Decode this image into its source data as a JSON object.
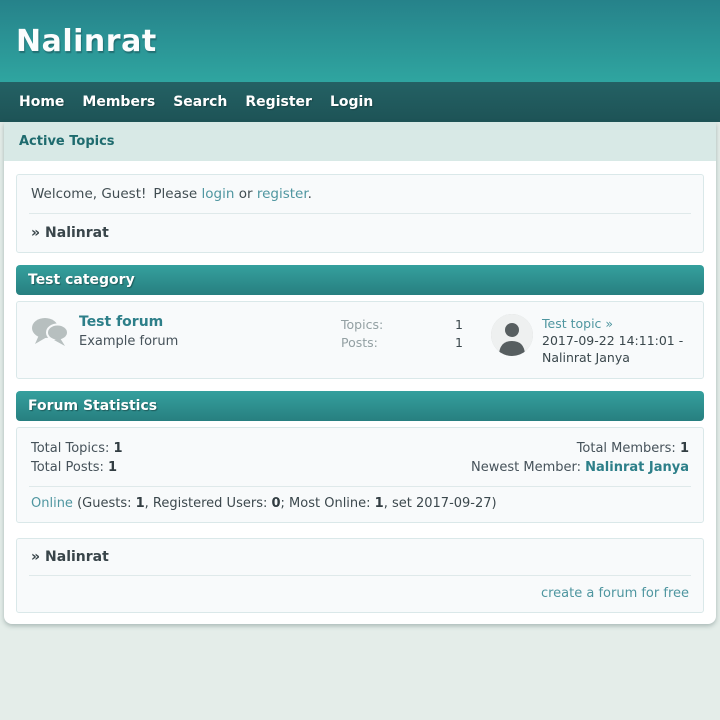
{
  "header": {
    "site_title": "Nalinrat"
  },
  "nav": {
    "items": [
      "Home",
      "Members",
      "Search",
      "Register",
      "Login"
    ]
  },
  "active_topics_bar": {
    "label": "Active Topics"
  },
  "welcome": {
    "greeting": "Welcome, Guest!",
    "please": "Please",
    "login_label": "login",
    "or": "or",
    "register_label": "register",
    "period": ".",
    "crumb_arrow": "»",
    "crumb_name": "Nalinrat"
  },
  "category": {
    "title": "Test category",
    "forum": {
      "name": "Test forum",
      "description": "Example forum",
      "topics_label": "Topics:",
      "topics_value": "1",
      "posts_label": "Posts:",
      "posts_value": "1",
      "last_topic_title": "Test topic »",
      "last_topic_date": "2017-09-22 14:11:01 -",
      "last_topic_author": "Nalinrat Janya"
    }
  },
  "stats": {
    "title": "Forum Statistics",
    "total_topics_label": "Total Topics:",
    "total_topics_value": "1",
    "total_posts_label": "Total Posts:",
    "total_posts_value": "1",
    "total_members_label": "Total Members:",
    "total_members_value": "1",
    "newest_member_label": "Newest Member:",
    "newest_member_name": "Nalinrat Janya",
    "online": {
      "link_label": "Online",
      "guests_prefix": "(Guests: ",
      "guests_value": "1",
      "registered_prefix": ", Registered Users: ",
      "registered_value": "0",
      "most_online_prefix": "; Most Online: ",
      "most_online_value": "1",
      "suffix": ", set 2017-09-27)"
    }
  },
  "footer": {
    "crumb_arrow": "»",
    "crumb_name": "Nalinrat",
    "create_forum_label": "create a forum for free"
  },
  "colors": {
    "header_gradient_top": "#26828a",
    "header_gradient_bottom": "#2fa5a0",
    "nav_background": "#215c5f",
    "breadcrumb_strip": "#d8e9e6",
    "section_header_teal": "#2b8f8f",
    "panel_background": "#f8fafb",
    "panel_border": "#dae8e9",
    "link": "#4f96a0",
    "link_bold": "#2d7f89",
    "text": "#3c484d",
    "muted_label": "#93a0a3",
    "page_background": "#e4ede9"
  },
  "icons": {
    "forum_icon": "chat-bubbles",
    "avatar_icon": "person-silhouette"
  }
}
